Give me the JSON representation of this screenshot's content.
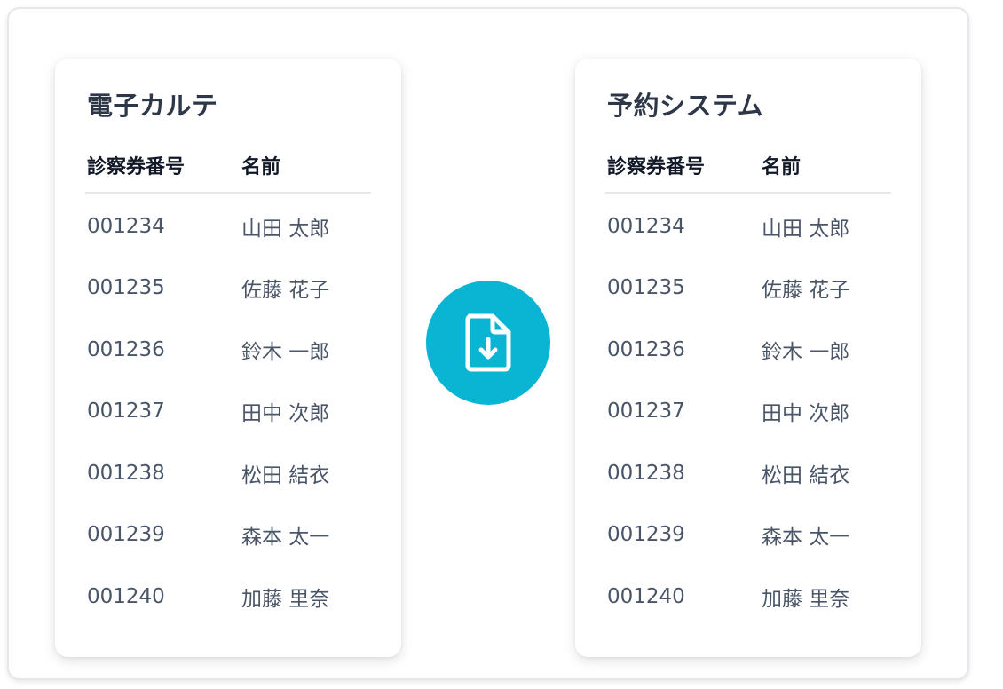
{
  "left_panel": {
    "title": "電子カルテ",
    "headers": {
      "id": "診察券番号",
      "name": "名前"
    },
    "rows": [
      {
        "id": "001234",
        "name": "山田 太郎"
      },
      {
        "id": "001235",
        "name": "佐藤 花子"
      },
      {
        "id": "001236",
        "name": "鈴木 一郎"
      },
      {
        "id": "001237",
        "name": "田中 次郎"
      },
      {
        "id": "001238",
        "name": "松田 結衣"
      },
      {
        "id": "001239",
        "name": "森本 太一"
      },
      {
        "id": "001240",
        "name": "加藤 里奈"
      }
    ]
  },
  "right_panel": {
    "title": "予約システム",
    "headers": {
      "id": "診察券番号",
      "name": "名前"
    },
    "rows": [
      {
        "id": "001234",
        "name": "山田 太郎"
      },
      {
        "id": "001235",
        "name": "佐藤 花子"
      },
      {
        "id": "001236",
        "name": "鈴木 一郎"
      },
      {
        "id": "001237",
        "name": "田中 次郎"
      },
      {
        "id": "001238",
        "name": "松田 結衣"
      },
      {
        "id": "001239",
        "name": "森本 太一"
      },
      {
        "id": "001240",
        "name": "加藤 里奈"
      }
    ]
  },
  "transfer_button": {
    "icon": "file-download-icon",
    "color": "#0ab5d3"
  }
}
